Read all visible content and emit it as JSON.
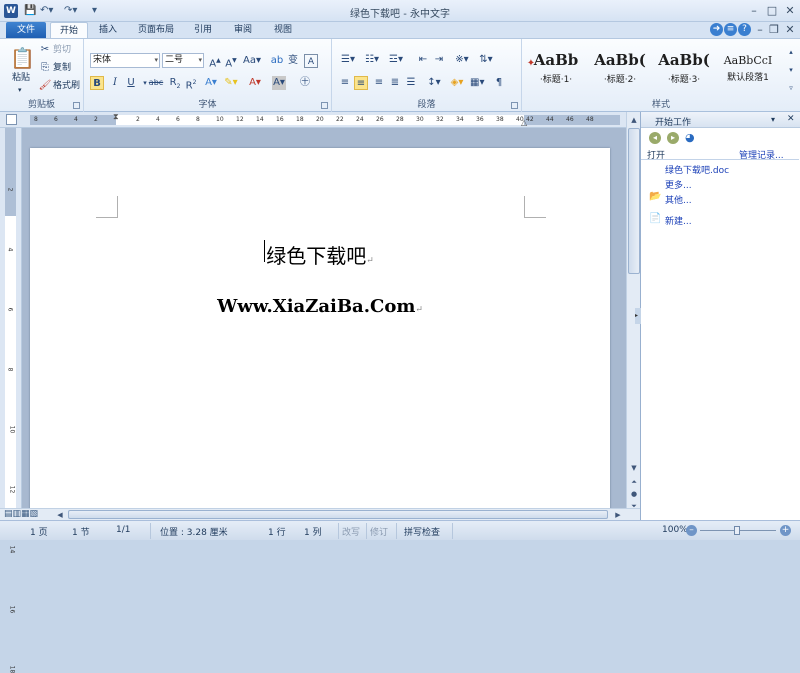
{
  "window": {
    "title": "绿色下载吧 - 永中文字",
    "app_icon": "W"
  },
  "tabs": [
    "文件",
    "开始",
    "插入",
    "页面布局",
    "引用",
    "审阅",
    "视图"
  ],
  "ribbon": {
    "clipboard": {
      "label": "剪贴板",
      "paste": "粘贴",
      "cut": "剪切",
      "copy": "复制",
      "format_painter": "格式刷"
    },
    "font": {
      "label": "字体",
      "font_name": "宋体",
      "font_size": "二号"
    },
    "paragraph": {
      "label": "段落"
    },
    "styles": {
      "label": "样式",
      "items": [
        {
          "preview": "AaBb",
          "name": "·标题·1·"
        },
        {
          "preview": "AaBb(",
          "name": "·标题·2·"
        },
        {
          "preview": "AaBb(",
          "name": "·标题·3·"
        },
        {
          "preview": "AaBbCcI",
          "name": "默认段落1"
        }
      ]
    }
  },
  "ruler": {
    "h_numbers": [
      "8",
      "6",
      "4",
      "2",
      "2",
      "4",
      "6",
      "8",
      "10",
      "12",
      "14",
      "16",
      "18",
      "20",
      "22",
      "24",
      "26",
      "28",
      "30",
      "32",
      "34",
      "36",
      "38",
      "40",
      "42",
      "44",
      "46",
      "48"
    ],
    "v_numbers": [
      "2",
      "4",
      "6",
      "8",
      "10",
      "12",
      "14",
      "16",
      "18"
    ]
  },
  "document": {
    "line1": "绿色下载吧",
    "line2": "Www.XiaZaiBa.Com"
  },
  "task_pane": {
    "title": "开始工作",
    "open_label": "打开",
    "manage_label": "管理记录...",
    "recent_file": "绿色下载吧.doc",
    "more": "更多...",
    "other": "其他...",
    "new": "新建..."
  },
  "status": {
    "page": "1 页",
    "section": "1 节",
    "page_of": "1/1",
    "position": "位置 : 3.28 厘米",
    "line": "1 行",
    "col": "1 列",
    "overwrite": "改写",
    "revise": "修订",
    "spell": "拼写检查",
    "zoom": "100%"
  }
}
